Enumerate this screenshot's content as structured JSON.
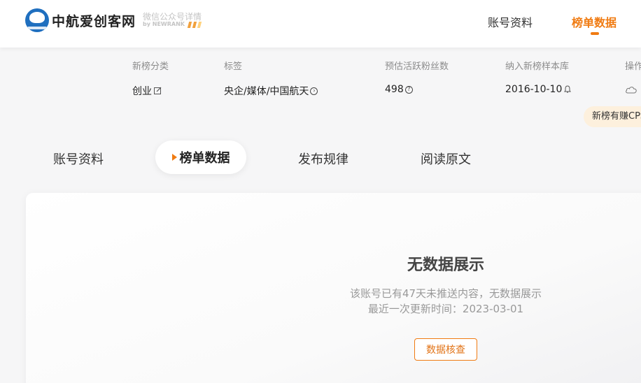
{
  "header": {
    "brand_name": "中航爱创客网",
    "sub_brand_line1": "微信公众号详情",
    "sub_brand_line2": "by NEWRANK",
    "nav": [
      {
        "label": "账号资料",
        "active": false
      },
      {
        "label": "榜单数据",
        "active": true
      }
    ]
  },
  "info_table": {
    "headers": [
      "新榜分类",
      "标签",
      "预估活跃粉丝数",
      "纳入新榜样本库",
      "操作"
    ],
    "category": "创业",
    "tags": "央企/媒体/中国航天",
    "active_fans": "498",
    "sample_date": "2016-10-10",
    "promo": "新榜有赚CPS"
  },
  "tabs": [
    {
      "label": "账号资料",
      "active": false
    },
    {
      "label": "榜单数据",
      "active": true
    },
    {
      "label": "发布规律",
      "active": false
    },
    {
      "label": "阅读原文",
      "active": false
    }
  ],
  "empty_state": {
    "title": "无数据展示",
    "line1": "该账号已有47天未推送内容，无数据展示",
    "line2": "最近一次更新时间：2023-03-01",
    "button": "数据核查"
  },
  "colors": {
    "accent": "#f07b12",
    "brand_blue": "#1f6fbf",
    "promo_bg": "#fdf0dd"
  },
  "icons": {
    "category": "edit-icon",
    "tags": "arrow-circle-icon",
    "fans": "question-circle-icon",
    "sample": "bell-icon",
    "operation": "cloud-icon"
  }
}
